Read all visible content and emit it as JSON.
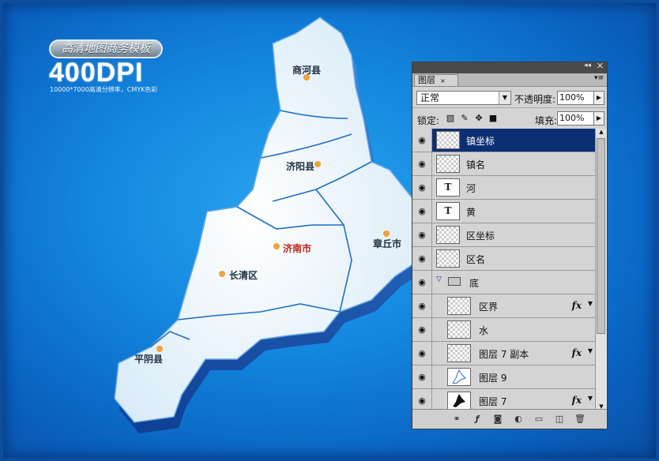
{
  "banner": {
    "subtitle": "高清地图商务模板",
    "dpi": "400DPI",
    "resolution": "10000*7000高清分辨率，CMYK色彩"
  },
  "map": {
    "cities": [
      {
        "name": "商河县",
        "style": "dark"
      },
      {
        "name": "济阳县",
        "style": "dark"
      },
      {
        "name": "济南市",
        "style": "red"
      },
      {
        "name": "章丘市",
        "style": "dark"
      },
      {
        "name": "长清区",
        "style": "dark"
      },
      {
        "name": "平阴县",
        "style": "dark"
      }
    ],
    "colors": {
      "land": "#e9f4fb",
      "edge": "#2f7fd6",
      "side": "#1b5fbe",
      "border": "#1e6fc7"
    }
  },
  "layers_panel": {
    "tab_label": "图层",
    "tab_close": "×",
    "blend_mode": "正常",
    "opacity_label": "不透明度:",
    "opacity_value": "100%",
    "lock_label": "锁定:",
    "fill_label": "填充:",
    "fill_value": "100%",
    "layers": [
      {
        "name": "镇坐标",
        "thumb": "checker",
        "selected": true,
        "fx": false,
        "indent": false
      },
      {
        "name": "镇名",
        "thumb": "checker",
        "selected": false,
        "fx": false,
        "indent": false
      },
      {
        "name": "河",
        "thumb": "text",
        "selected": false,
        "fx": false,
        "indent": false
      },
      {
        "name": "黄",
        "thumb": "text",
        "selected": false,
        "fx": false,
        "indent": false
      },
      {
        "name": "区坐标",
        "thumb": "checker",
        "selected": false,
        "fx": false,
        "indent": false
      },
      {
        "name": "区名",
        "thumb": "checker",
        "selected": false,
        "fx": false,
        "indent": false
      },
      {
        "name": "底",
        "thumb": "group",
        "selected": false,
        "fx": false,
        "indent": false
      },
      {
        "name": "区界",
        "thumb": "checker",
        "selected": false,
        "fx": true,
        "indent": true
      },
      {
        "name": "水",
        "thumb": "checker",
        "selected": false,
        "fx": false,
        "indent": true
      },
      {
        "name": "图层 7 副本",
        "thumb": "checker",
        "selected": false,
        "fx": true,
        "indent": true
      },
      {
        "name": "图层 9",
        "thumb": "pic",
        "selected": false,
        "fx": false,
        "indent": true
      },
      {
        "name": "图层 7",
        "thumb": "pic",
        "selected": false,
        "fx": true,
        "indent": true
      }
    ],
    "fx_label": "fx",
    "text_thumb_glyph": "T"
  }
}
